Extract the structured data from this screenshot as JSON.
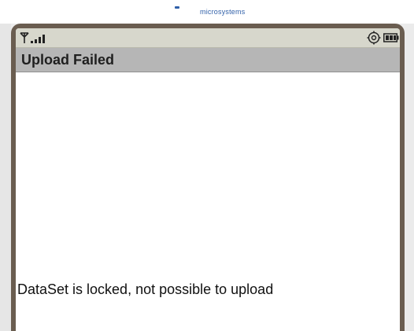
{
  "branding": {
    "text": "microsystems"
  },
  "status_bar": {
    "icons": [
      "antenna-icon",
      "signal-bars-icon",
      "settings-icon",
      "battery-icon"
    ]
  },
  "screen": {
    "title": "Upload Failed",
    "message": "DataSet is locked, not possible to upload"
  },
  "colors": {
    "frame": "#6a5d50",
    "status_bar": "#d7d7cc",
    "title_bar": "#b6b6b6",
    "screen": "#ffffff",
    "brand": "#2f5fa8"
  }
}
